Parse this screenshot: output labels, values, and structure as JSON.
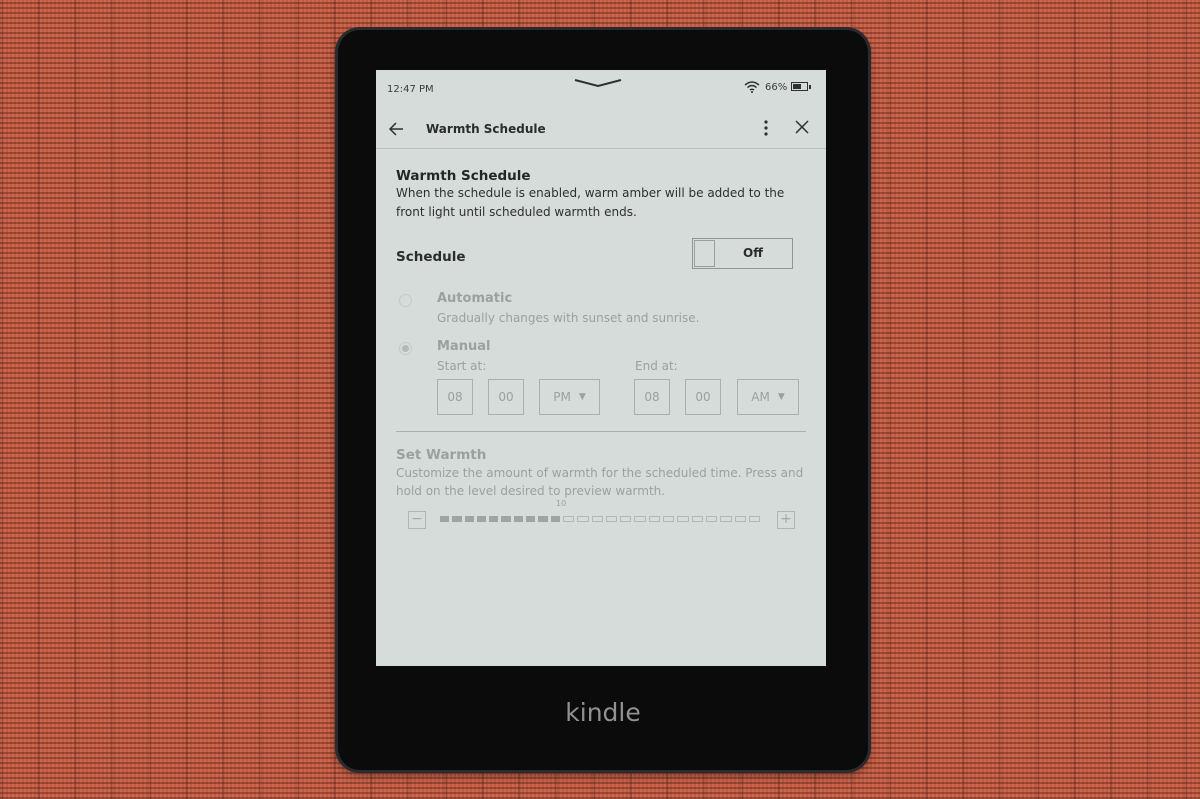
{
  "device": {
    "brand": "kindle"
  },
  "status_bar": {
    "time": "12:47 PM",
    "battery_percent": "66%",
    "battery_level": 0.66,
    "wifi_icon": "wifi-icon",
    "pulldown_icon": "chevron-down-icon"
  },
  "header": {
    "title": "Warmth Schedule",
    "back_icon": "arrow-left-icon",
    "menu_icon": "more-vertical-icon",
    "close_icon": "close-icon"
  },
  "intro": {
    "heading": "Warmth Schedule",
    "description": "When the schedule is enabled, warm amber will be added to the front light until scheduled warmth ends."
  },
  "schedule": {
    "label": "Schedule",
    "toggle_state": "Off",
    "enabled": false
  },
  "options": [
    {
      "title": "Automatic",
      "subtitle": "Gradually changes with sunset and sunrise.",
      "selected": false
    },
    {
      "title": "Manual",
      "subtitle": "",
      "selected": true
    }
  ],
  "manual": {
    "start_label": "Start at:",
    "start": {
      "hour": "08",
      "minute": "00",
      "period": "PM"
    },
    "end_label": "End at:",
    "end": {
      "hour": "08",
      "minute": "00",
      "period": "AM"
    }
  },
  "set_warmth": {
    "title": "Set Warmth",
    "description": "Customize the amount of warmth for the scheduled time. Press and hold on the level desired to preview warmth.",
    "level": 10,
    "level_label": "10",
    "max_level": 24,
    "minus": "−",
    "plus": "+"
  }
}
